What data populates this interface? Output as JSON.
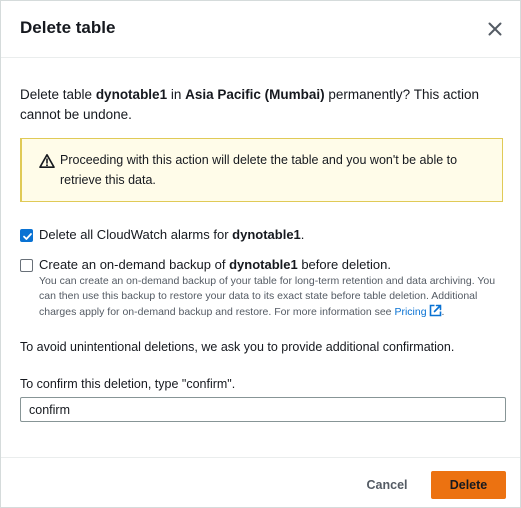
{
  "dialog": {
    "title": "Delete table",
    "intro": {
      "prefix": "Delete table ",
      "table_name": "dynotable1",
      "middle": " in ",
      "region": "Asia Pacific (Mumbai)",
      "suffix": " permanently? This action cannot be undone."
    },
    "warning": {
      "icon": "warning-icon",
      "text": "Proceeding with this action will delete the table and you won't be able to retrieve this data."
    },
    "cloudwatch_option": {
      "checked": true,
      "prefix": "Delete all CloudWatch alarms for ",
      "table_name": "dynotable1",
      "suffix": "."
    },
    "backup_option": {
      "checked": false,
      "prefix": "Create an on-demand backup of ",
      "table_name": "dynotable1",
      "suffix": " before deletion.",
      "description": "You can create an on-demand backup of your table for long-term retention and data archiving. You can then use this backup to restore your data to its exact state before table deletion. Additional charges apply for on-demand backup and restore. For more information see ",
      "link_text": "Pricing",
      "link_suffix": "."
    },
    "avoid_text": "To avoid unintentional deletions, we ask you to provide additional confirmation.",
    "confirm_label": "To confirm this deletion, type \"confirm\".",
    "confirm_value": "confirm",
    "cancel_label": "Cancel",
    "delete_label": "Delete"
  },
  "colors": {
    "accent": "#0972d3",
    "primary_button": "#ec7211",
    "warning_bg": "#fffce9",
    "warning_border": "#e0ca57"
  }
}
